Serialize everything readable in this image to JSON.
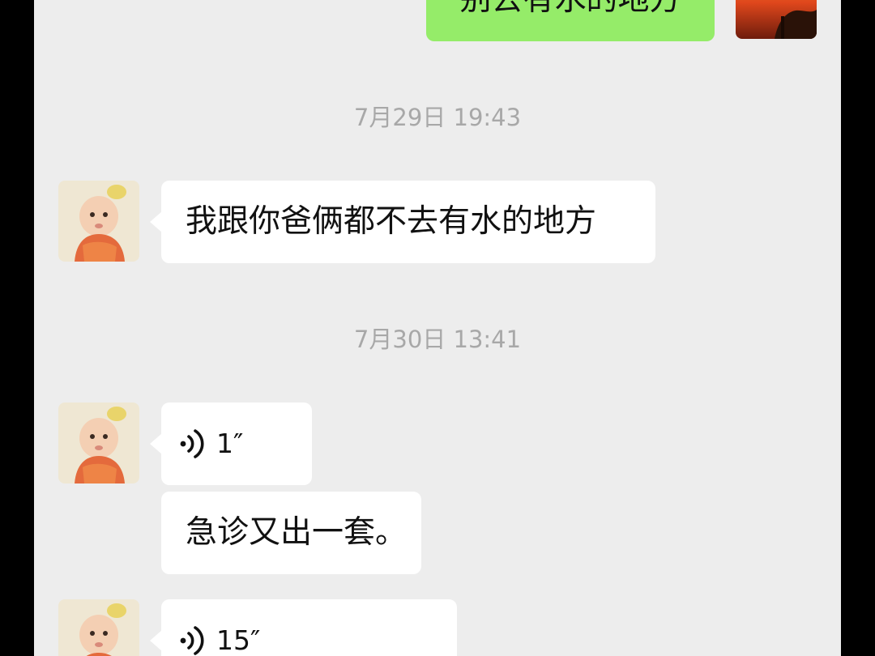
{
  "messages": {
    "sent_top": {
      "text": "别去有水的地方"
    },
    "timestamp_1": "7月29日 19:43",
    "received_1": {
      "text": "我跟你爸俩都不去有水的地方"
    },
    "timestamp_2": "7月30日 13:41",
    "voice_1": {
      "duration": "1″"
    },
    "received_2": {
      "text": "急诊又出一套。"
    },
    "voice_2": {
      "duration": "15″"
    }
  },
  "colors": {
    "background": "#ededed",
    "received_bubble": "#ffffff",
    "sent_bubble": "#95ec69",
    "timestamp_text": "#a8a8a8"
  },
  "icons": {
    "voice": "voice-wave-icon"
  }
}
